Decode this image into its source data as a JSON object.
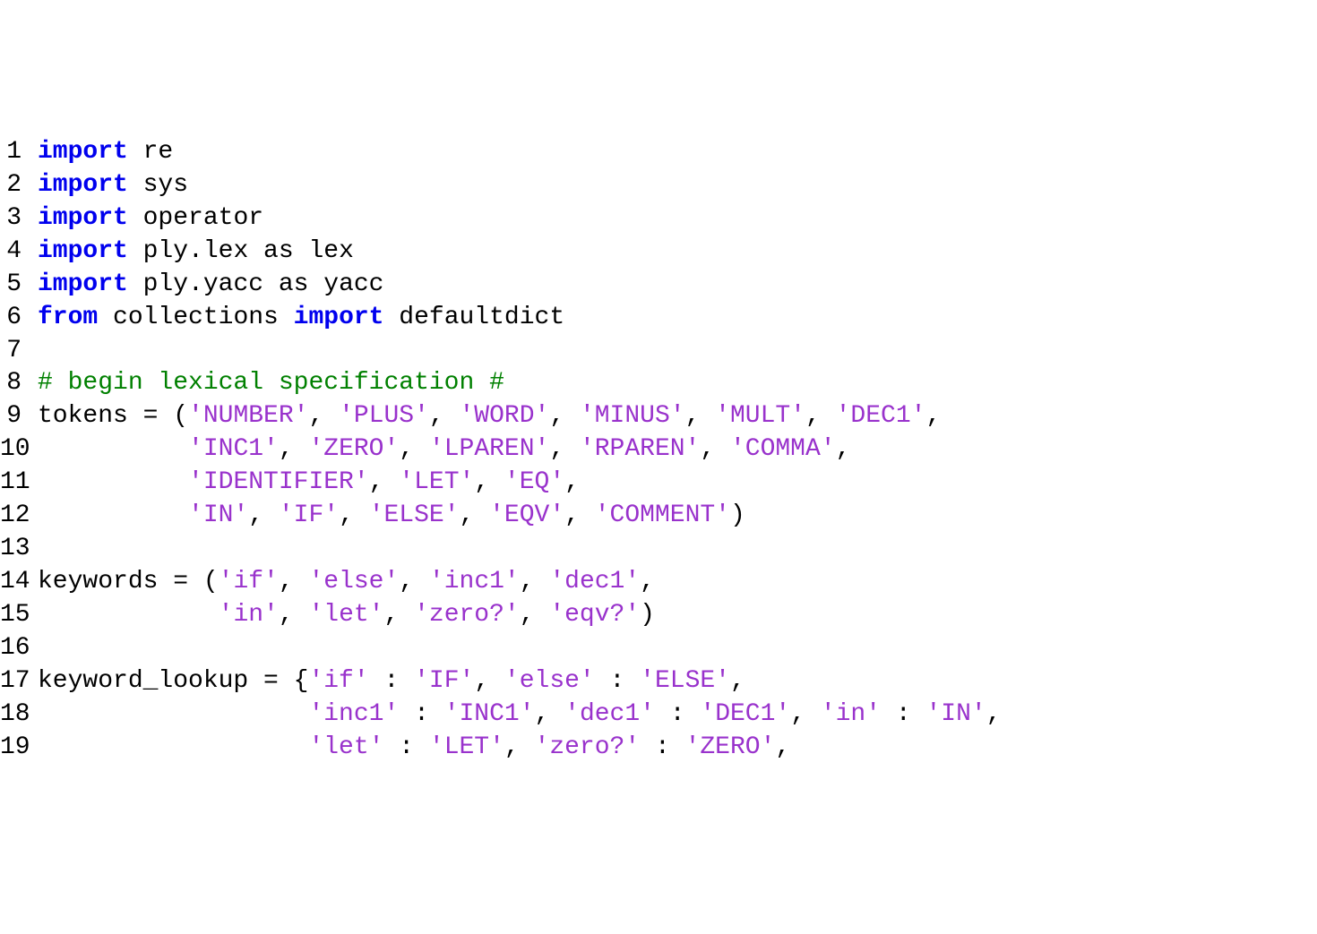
{
  "colors": {
    "keyword": "#0000ee",
    "string": "#9932cc",
    "comment": "#008000",
    "default": "#000000",
    "background": "#ffffff"
  },
  "lines": [
    {
      "n": "1",
      "tokens": [
        {
          "kind": "kw",
          "text": "import"
        },
        {
          "kind": "code",
          "text": " re"
        }
      ]
    },
    {
      "n": "2",
      "tokens": [
        {
          "kind": "kw",
          "text": "import"
        },
        {
          "kind": "code",
          "text": " sys"
        }
      ]
    },
    {
      "n": "3",
      "tokens": [
        {
          "kind": "kw",
          "text": "import"
        },
        {
          "kind": "code",
          "text": " operator"
        }
      ]
    },
    {
      "n": "4",
      "tokens": [
        {
          "kind": "kw",
          "text": "import"
        },
        {
          "kind": "code",
          "text": " ply.lex as lex"
        }
      ]
    },
    {
      "n": "5",
      "tokens": [
        {
          "kind": "kw",
          "text": "import"
        },
        {
          "kind": "code",
          "text": " ply.yacc as yacc"
        }
      ]
    },
    {
      "n": "6",
      "tokens": [
        {
          "kind": "kw",
          "text": "from"
        },
        {
          "kind": "code",
          "text": " collections "
        },
        {
          "kind": "kw",
          "text": "import"
        },
        {
          "kind": "code",
          "text": " defaultdict"
        }
      ]
    },
    {
      "n": "7",
      "tokens": []
    },
    {
      "n": "8",
      "tokens": [
        {
          "kind": "cmt",
          "text": "# begin lexical specification #"
        }
      ]
    },
    {
      "n": "9",
      "tokens": [
        {
          "kind": "code",
          "text": "tokens = ("
        },
        {
          "kind": "str",
          "text": "'NUMBER'"
        },
        {
          "kind": "code",
          "text": ", "
        },
        {
          "kind": "str",
          "text": "'PLUS'"
        },
        {
          "kind": "code",
          "text": ", "
        },
        {
          "kind": "str",
          "text": "'WORD'"
        },
        {
          "kind": "code",
          "text": ", "
        },
        {
          "kind": "str",
          "text": "'MINUS'"
        },
        {
          "kind": "code",
          "text": ", "
        },
        {
          "kind": "str",
          "text": "'MULT'"
        },
        {
          "kind": "code",
          "text": ", "
        },
        {
          "kind": "str",
          "text": "'DEC1'"
        },
        {
          "kind": "code",
          "text": ","
        }
      ]
    },
    {
      "n": "10",
      "tokens": [
        {
          "kind": "code",
          "text": "          "
        },
        {
          "kind": "str",
          "text": "'INC1'"
        },
        {
          "kind": "code",
          "text": ", "
        },
        {
          "kind": "str",
          "text": "'ZERO'"
        },
        {
          "kind": "code",
          "text": ", "
        },
        {
          "kind": "str",
          "text": "'LPAREN'"
        },
        {
          "kind": "code",
          "text": ", "
        },
        {
          "kind": "str",
          "text": "'RPAREN'"
        },
        {
          "kind": "code",
          "text": ", "
        },
        {
          "kind": "str",
          "text": "'COMMA'"
        },
        {
          "kind": "code",
          "text": ","
        }
      ]
    },
    {
      "n": "11",
      "tokens": [
        {
          "kind": "code",
          "text": "          "
        },
        {
          "kind": "str",
          "text": "'IDENTIFIER'"
        },
        {
          "kind": "code",
          "text": ", "
        },
        {
          "kind": "str",
          "text": "'LET'"
        },
        {
          "kind": "code",
          "text": ", "
        },
        {
          "kind": "str",
          "text": "'EQ'"
        },
        {
          "kind": "code",
          "text": ","
        }
      ]
    },
    {
      "n": "12",
      "tokens": [
        {
          "kind": "code",
          "text": "          "
        },
        {
          "kind": "str",
          "text": "'IN'"
        },
        {
          "kind": "code",
          "text": ", "
        },
        {
          "kind": "str",
          "text": "'IF'"
        },
        {
          "kind": "code",
          "text": ", "
        },
        {
          "kind": "str",
          "text": "'ELSE'"
        },
        {
          "kind": "code",
          "text": ", "
        },
        {
          "kind": "str",
          "text": "'EQV'"
        },
        {
          "kind": "code",
          "text": ", "
        },
        {
          "kind": "str",
          "text": "'COMMENT'"
        },
        {
          "kind": "code",
          "text": ")"
        }
      ]
    },
    {
      "n": "13",
      "tokens": []
    },
    {
      "n": "14",
      "tokens": [
        {
          "kind": "code",
          "text": "keywords = ("
        },
        {
          "kind": "str",
          "text": "'if'"
        },
        {
          "kind": "code",
          "text": ", "
        },
        {
          "kind": "str",
          "text": "'else'"
        },
        {
          "kind": "code",
          "text": ", "
        },
        {
          "kind": "str",
          "text": "'inc1'"
        },
        {
          "kind": "code",
          "text": ", "
        },
        {
          "kind": "str",
          "text": "'dec1'"
        },
        {
          "kind": "code",
          "text": ","
        }
      ]
    },
    {
      "n": "15",
      "tokens": [
        {
          "kind": "code",
          "text": "            "
        },
        {
          "kind": "str",
          "text": "'in'"
        },
        {
          "kind": "code",
          "text": ", "
        },
        {
          "kind": "str",
          "text": "'let'"
        },
        {
          "kind": "code",
          "text": ", "
        },
        {
          "kind": "str",
          "text": "'zero?'"
        },
        {
          "kind": "code",
          "text": ", "
        },
        {
          "kind": "str",
          "text": "'eqv?'"
        },
        {
          "kind": "code",
          "text": ")"
        }
      ]
    },
    {
      "n": "16",
      "tokens": []
    },
    {
      "n": "17",
      "tokens": [
        {
          "kind": "code",
          "text": "keyword_lookup = {"
        },
        {
          "kind": "str",
          "text": "'if'"
        },
        {
          "kind": "code",
          "text": " : "
        },
        {
          "kind": "str",
          "text": "'IF'"
        },
        {
          "kind": "code",
          "text": ", "
        },
        {
          "kind": "str",
          "text": "'else'"
        },
        {
          "kind": "code",
          "text": " : "
        },
        {
          "kind": "str",
          "text": "'ELSE'"
        },
        {
          "kind": "code",
          "text": ","
        }
      ]
    },
    {
      "n": "18",
      "tokens": [
        {
          "kind": "code",
          "text": "                  "
        },
        {
          "kind": "str",
          "text": "'inc1'"
        },
        {
          "kind": "code",
          "text": " : "
        },
        {
          "kind": "str",
          "text": "'INC1'"
        },
        {
          "kind": "code",
          "text": ", "
        },
        {
          "kind": "str",
          "text": "'dec1'"
        },
        {
          "kind": "code",
          "text": " : "
        },
        {
          "kind": "str",
          "text": "'DEC1'"
        },
        {
          "kind": "code",
          "text": ", "
        },
        {
          "kind": "str",
          "text": "'in'"
        },
        {
          "kind": "code",
          "text": " : "
        },
        {
          "kind": "str",
          "text": "'IN'"
        },
        {
          "kind": "code",
          "text": ","
        }
      ]
    },
    {
      "n": "19",
      "tokens": [
        {
          "kind": "code",
          "text": "                  "
        },
        {
          "kind": "str",
          "text": "'let'"
        },
        {
          "kind": "code",
          "text": " : "
        },
        {
          "kind": "str",
          "text": "'LET'"
        },
        {
          "kind": "code",
          "text": ", "
        },
        {
          "kind": "str",
          "text": "'zero?'"
        },
        {
          "kind": "code",
          "text": " : "
        },
        {
          "kind": "str",
          "text": "'ZERO'"
        },
        {
          "kind": "code",
          "text": ","
        }
      ]
    }
  ]
}
